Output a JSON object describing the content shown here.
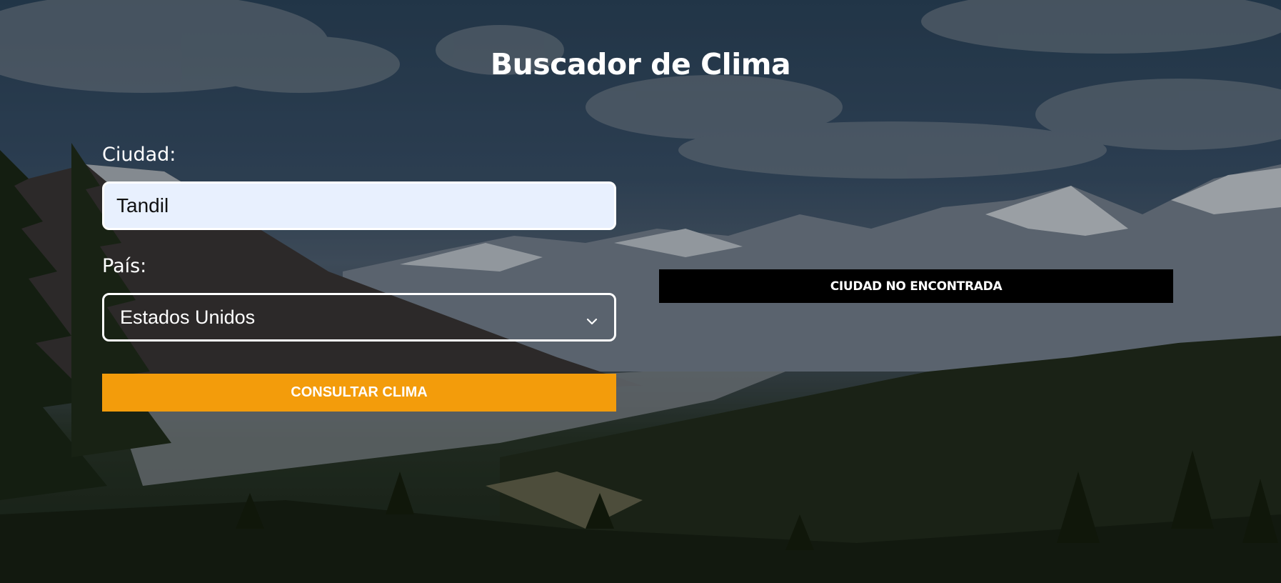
{
  "page": {
    "title": "Buscador de Clima"
  },
  "form": {
    "city_label": "Ciudad:",
    "city_value": "Tandil",
    "country_label": "País:",
    "country_selected": "Estados Unidos",
    "submit_label": "CONSULTAR CLIMA"
  },
  "alert": {
    "message": "CIUDAD NO ENCONTRADA"
  },
  "colors": {
    "submit_button": "#f39c0b",
    "alert_background": "#000000",
    "city_input_background": "#e8f0fe",
    "text": "#ffffff"
  },
  "icons": {
    "select_arrow": "chevron-down-icon"
  }
}
